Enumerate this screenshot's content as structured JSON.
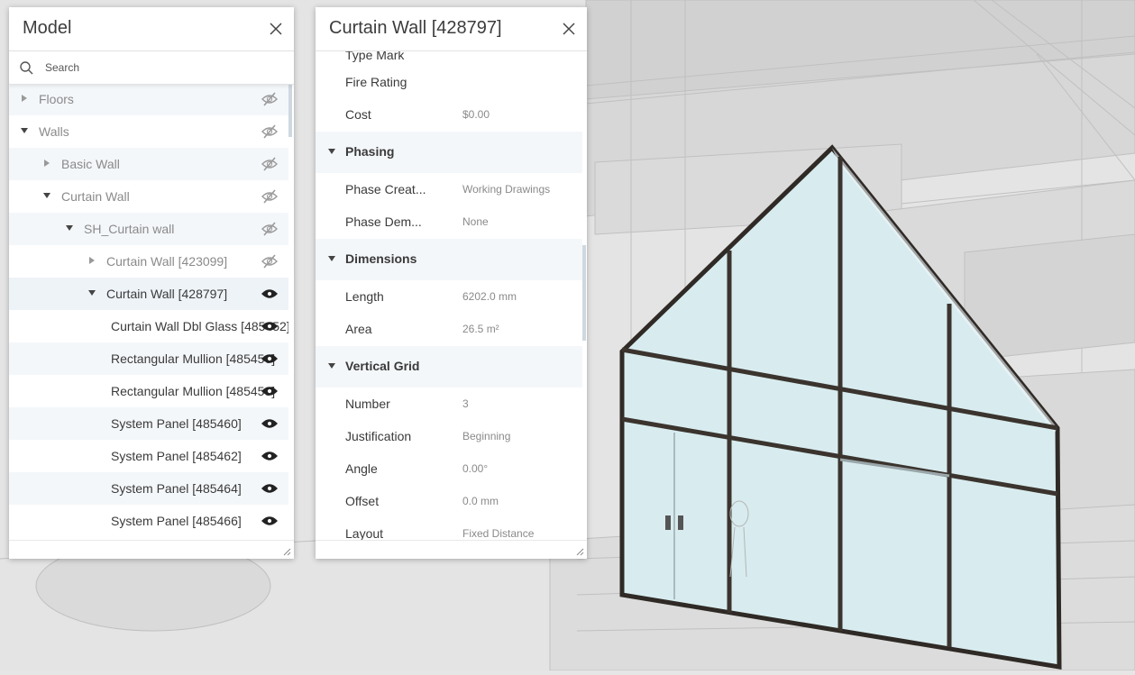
{
  "model_panel": {
    "title": "Model",
    "search_placeholder": "Search",
    "tree": [
      {
        "label": "Floors",
        "arrow": "collapsed",
        "visible": false
      },
      {
        "label": "Walls",
        "arrow": "expanded",
        "visible": false
      },
      {
        "label": "Basic Wall",
        "arrow": "collapsed",
        "visible": false
      },
      {
        "label": "Curtain Wall",
        "arrow": "expanded",
        "visible": false
      },
      {
        "label": "SH_Curtain wall",
        "arrow": "expanded",
        "visible": false
      },
      {
        "label": "Curtain Wall [423099]",
        "arrow": "collapsed",
        "visible": false
      },
      {
        "label": "Curtain Wall [428797]",
        "arrow": "expanded",
        "visible": true,
        "selected": true
      },
      {
        "label": "Curtain Wall Dbl Glass [485452]",
        "arrow": "none",
        "visible": true
      },
      {
        "label": "Rectangular Mullion [485456]",
        "arrow": "none",
        "visible": true
      },
      {
        "label": "Rectangular Mullion [485458]",
        "arrow": "none",
        "visible": true
      },
      {
        "label": "System Panel [485460]",
        "arrow": "none",
        "visible": true
      },
      {
        "label": "System Panel [485462]",
        "arrow": "none",
        "visible": true
      },
      {
        "label": "System Panel [485464]",
        "arrow": "none",
        "visible": true
      },
      {
        "label": "System Panel [485466]",
        "arrow": "none",
        "visible": true
      }
    ]
  },
  "props_panel": {
    "title": "Curtain Wall [428797]",
    "partial_top_label": "Type Mark",
    "rows": [
      {
        "type": "prop",
        "key": "Fire Rating",
        "value": ""
      },
      {
        "type": "prop",
        "key": "Cost",
        "value": "$0.00"
      },
      {
        "type": "cat",
        "key": "Phasing"
      },
      {
        "type": "prop",
        "key": "Phase Creat...",
        "value": "Working Drawings"
      },
      {
        "type": "prop",
        "key": "Phase Dem...",
        "value": "None"
      },
      {
        "type": "cat",
        "key": "Dimensions"
      },
      {
        "type": "prop",
        "key": "Length",
        "value": "6202.0 mm"
      },
      {
        "type": "prop",
        "key": "Area",
        "value": "26.5 m²"
      },
      {
        "type": "cat",
        "key": "Vertical Grid"
      },
      {
        "type": "prop",
        "key": "Number",
        "value": "3"
      },
      {
        "type": "prop",
        "key": "Justification",
        "value": "Beginning"
      },
      {
        "type": "prop",
        "key": "Angle",
        "value": "0.00°"
      },
      {
        "type": "prop",
        "key": "Offset",
        "value": "0.0 mm"
      },
      {
        "type": "prop",
        "key": "Layout",
        "value": "Fixed Distance"
      }
    ]
  },
  "icons": {
    "close": "close-icon",
    "search": "search-icon",
    "eye_visible": "eye-icon",
    "eye_hidden": "eye-slash-icon",
    "arrow_collapsed": "caret-right-icon",
    "arrow_expanded": "caret-down-icon"
  },
  "colors": {
    "accent_selected_row": "#eef3f8",
    "alt_row": "#f4f7fa",
    "glass": "#d8ecef",
    "mullion": "#3b342e"
  }
}
